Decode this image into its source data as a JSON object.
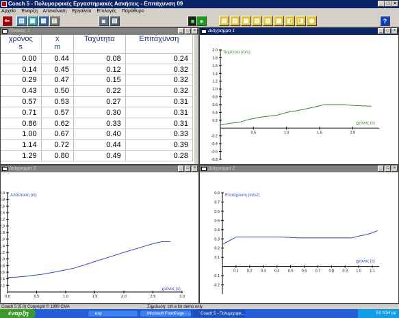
{
  "app": {
    "title": "Coach 5 - Πολυμορφικές Εργαστηριακές Ασκήσεις - Επιτάχυνση 09"
  },
  "menu": [
    "Αρχείο",
    "Έναρξη",
    "Απεικόνιση",
    "Εργαλεία",
    "Επιλογές",
    "Παράθυρο"
  ],
  "table_window": {
    "title": "Πίνακας 1",
    "columns": [
      {
        "name": "χρόνος",
        "unit": "s"
      },
      {
        "name": "x",
        "unit": "m"
      },
      {
        "name": "Ταχύτητα",
        "unit": ""
      },
      {
        "name": "Επιτάχυνση",
        "unit": ""
      }
    ],
    "rows": [
      [
        "0.00",
        "0.44",
        "0.08",
        "0.24"
      ],
      [
        "0.14",
        "0.45",
        "0.12",
        "0.32"
      ],
      [
        "0.29",
        "0.47",
        "0.15",
        "0.32"
      ],
      [
        "0.43",
        "0.50",
        "0.22",
        "0.32"
      ],
      [
        "0.57",
        "0.53",
        "0.27",
        "0.31"
      ],
      [
        "0.71",
        "0.57",
        "0.30",
        "0.31"
      ],
      [
        "0.86",
        "0.62",
        "0.33",
        "0.31"
      ],
      [
        "1.00",
        "0.67",
        "0.40",
        "0.33"
      ],
      [
        "1.14",
        "0.72",
        "0.44",
        "0.39"
      ],
      [
        "1.29",
        "0.80",
        "0.49",
        "0.28"
      ]
    ]
  },
  "chart_data": [
    {
      "window_title": "Διάγραμμα 1",
      "type": "line",
      "ylabel": "Ταχύτητα (m/s)",
      "xlabel": "χρόνος (s)",
      "color": "#2e8b2e",
      "xlim": [
        0,
        2.4
      ],
      "ylim": [
        -0.8,
        2.0
      ],
      "xticks": [
        0.5,
        1.0,
        1.5,
        2.0
      ],
      "yticks": [
        -0.8,
        -0.6,
        -0.4,
        -0.2,
        0.2,
        0.4,
        0.6,
        0.8,
        1.0,
        1.2,
        1.4,
        1.6,
        1.8,
        2.0
      ],
      "x": [
        0.0,
        0.14,
        0.29,
        0.43,
        0.57,
        0.71,
        0.86,
        1.0,
        1.14,
        1.29,
        1.43,
        1.57,
        1.71,
        1.86,
        2.0,
        2.14,
        2.28
      ],
      "y": [
        0.08,
        0.12,
        0.15,
        0.22,
        0.27,
        0.3,
        0.33,
        0.4,
        0.44,
        0.49,
        0.54,
        0.6,
        0.6,
        0.6,
        0.58,
        0.57,
        0.56
      ]
    },
    {
      "window_title": "Διάγραμμα 3",
      "type": "line",
      "ylabel": "Απόσταση (m)",
      "xlabel": "χρόνος (s)",
      "color": "#2f3fd6",
      "xlim": [
        0,
        3.0
      ],
      "ylim": [
        0,
        3.0
      ],
      "xticks": [
        0.0,
        0.5,
        1.0,
        1.5,
        2.0,
        2.5,
        3.0
      ],
      "yticks": [
        0.2,
        0.4,
        0.6,
        0.8,
        1.0,
        1.2,
        1.4,
        1.6,
        1.8,
        2.0,
        2.2,
        2.4,
        2.6,
        2.8,
        3.0
      ],
      "x": [
        0.0,
        0.14,
        0.29,
        0.43,
        0.57,
        0.71,
        0.86,
        1.0,
        1.14,
        1.29,
        1.5,
        1.75,
        2.0,
        2.25,
        2.5,
        2.65,
        2.8
      ],
      "y": [
        0.44,
        0.45,
        0.47,
        0.5,
        0.53,
        0.57,
        0.62,
        0.67,
        0.72,
        0.8,
        0.92,
        1.06,
        1.2,
        1.33,
        1.46,
        1.52,
        1.52
      ]
    },
    {
      "window_title": "Διάγραμμα 2",
      "type": "line",
      "ylabel": "Επιτάχυνση (m/s2)",
      "xlabel": "χρόνος (s)",
      "color": "#2f3fd6",
      "xlim": [
        0,
        1.15
      ],
      "ylim": [
        -0.3,
        0.8
      ],
      "xticks": [
        0.1,
        0.2,
        0.3,
        0.4,
        0.5,
        0.6,
        0.7,
        0.8,
        0.9,
        1.0,
        1.1
      ],
      "yticks": [
        -0.2,
        -0.1,
        0.1,
        0.2,
        0.3,
        0.4,
        0.5,
        0.6,
        0.7,
        0.8
      ],
      "x": [
        0.0,
        0.05,
        0.1,
        0.14,
        0.29,
        0.43,
        0.57,
        0.71,
        0.86,
        0.95,
        1.0,
        1.07,
        1.14
      ],
      "y": [
        0.24,
        0.28,
        0.32,
        0.32,
        0.32,
        0.32,
        0.31,
        0.31,
        0.31,
        0.31,
        0.33,
        0.35,
        0.39
      ]
    }
  ],
  "status": {
    "left": "Coach 5 (5.0) Copyright © 1999 CMA",
    "right": "Σημείωση: ctrl-a for demo only"
  },
  "taskbar": {
    "start": "έναρξη",
    "tasks": [
      "exp",
      "Microsoft FrontPage - ...",
      "Coach 5 - Πολυμορφικ..."
    ],
    "tray": "ΕΛ  9:54 μμ"
  }
}
